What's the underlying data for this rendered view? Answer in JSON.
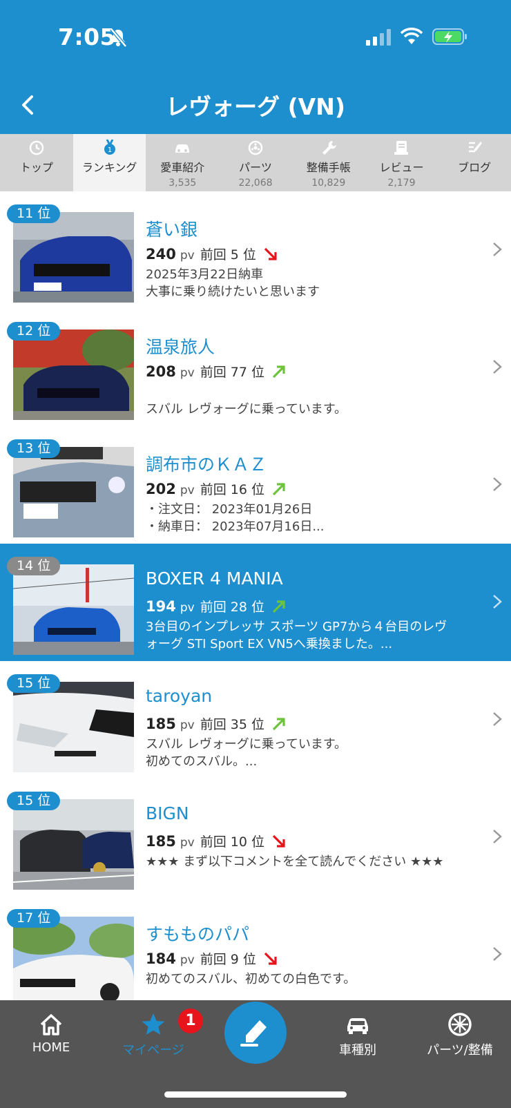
{
  "status_bar": {
    "time": "7:05"
  },
  "header": {
    "title": "レヴォーグ (VN)"
  },
  "tabs": [
    {
      "label": "トップ",
      "count": "",
      "icon": "clock-icon"
    },
    {
      "label": "ランキング",
      "count": "",
      "icon": "medal-icon"
    },
    {
      "label": "愛車紹介",
      "count": "3,535",
      "icon": "car-icon"
    },
    {
      "label": "パーツ",
      "count": "22,068",
      "icon": "wheel-icon"
    },
    {
      "label": "整備手帳",
      "count": "10,829",
      "icon": "wrench-icon"
    },
    {
      "label": "レビュー",
      "count": "2,179",
      "icon": "review-icon"
    },
    {
      "label": "ブログ",
      "count": "",
      "icon": "blog-icon"
    }
  ],
  "rankings": [
    {
      "rank": "11 位",
      "name": "蒼い銀",
      "pv": "240",
      "pv_unit": "pv",
      "prev": "前回 5 位",
      "trend": "down",
      "desc": [
        "2025年3月22日納車",
        "大事に乗り続けたいと思います"
      ]
    },
    {
      "rank": "12 位",
      "name": "温泉旅人",
      "pv": "208",
      "pv_unit": "pv",
      "prev": "前回 77 位",
      "trend": "up",
      "desc": [
        "",
        "スバル レヴォーグに乗っています。"
      ]
    },
    {
      "rank": "13 位",
      "name": "調布市のＫＡＺ",
      "pv": "202",
      "pv_unit": "pv",
      "prev": "前回 16 位",
      "trend": "up",
      "desc": [
        "・注文日： 2023年01月26日",
        "・納車日： 2023年07月16日..."
      ]
    },
    {
      "rank": "14 位",
      "name": "BOXER 4 MANIA",
      "pv": "194",
      "pv_unit": "pv",
      "prev": "前回 28 位",
      "trend": "up",
      "desc": [
        "3台目のインプレッサ スポーツ GP7から４台目のレヴ",
        "ォーグ STI Sport EX VN5へ乗換ました。..."
      ]
    },
    {
      "rank": "15 位",
      "name": "taroyan",
      "pv": "185",
      "pv_unit": "pv",
      "prev": "前回 35 位",
      "trend": "up",
      "desc": [
        "スバル レヴォーグに乗っています。",
        "初めてのスバル。..."
      ]
    },
    {
      "rank": "15 位",
      "name": "BIGN",
      "pv": "185",
      "pv_unit": "pv",
      "prev": "前回 10 位",
      "trend": "down",
      "desc": [
        "★★★ まず以下コメントを全て読んでください ★★★",
        ""
      ]
    },
    {
      "rank": "17 位",
      "name": "すもものパパ",
      "pv": "184",
      "pv_unit": "pv",
      "prev": "前回 9 位",
      "trend": "down",
      "desc": [
        "初めてのスバル、初めての白色です。",
        ""
      ]
    }
  ],
  "bottom_nav": {
    "home": "HOME",
    "mypage": "マイページ",
    "mypage_badge": "1",
    "car_types": "車種別",
    "parts": "パーツ/整備"
  },
  "colors": {
    "primary": "#1e8fce",
    "trend_up": "#6cc43a",
    "trend_down": "#e8141b",
    "nav_bg": "#555556"
  }
}
